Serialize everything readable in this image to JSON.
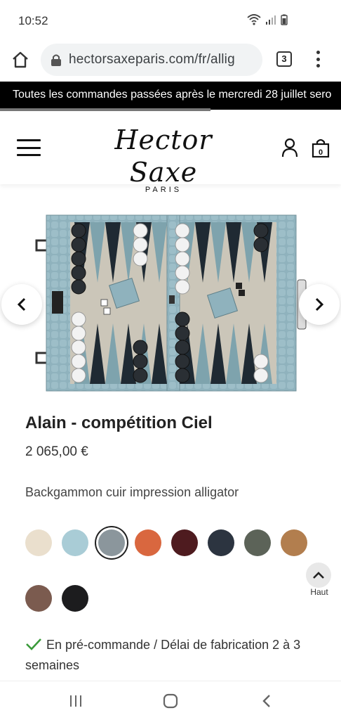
{
  "status_bar": {
    "time": "10:52"
  },
  "browser": {
    "url": "hectorsaxeparis.com/fr/allig",
    "tab_count": "3"
  },
  "promo": {
    "text": "Toutes les commandes passées après le mercredi 28 juillet sero"
  },
  "header": {
    "logo_main": "Hector Saxe",
    "logo_sub": "PARIS"
  },
  "product": {
    "title": "Alain - compétition Ciel",
    "price": "2 065,00 €",
    "description": "Backgammon cuir impression alligator",
    "availability": "En pré-commande / Délai de fabrication 2 à 3 semaines"
  },
  "swatches": [
    {
      "color": "#eadfcd",
      "selected": false
    },
    {
      "color": "#a9ccd6",
      "selected": false
    },
    {
      "color": "#8b969c",
      "selected": true
    },
    {
      "color": "#d9673f",
      "selected": false
    },
    {
      "color": "#4e1b1f",
      "selected": false
    },
    {
      "color": "#2c3440",
      "selected": false
    },
    {
      "color": "#5c6358",
      "selected": false
    },
    {
      "color": "#b27e4e",
      "selected": false
    },
    {
      "color": "#7b5b4f",
      "selected": false
    },
    {
      "color": "#1c1c1e",
      "selected": false
    }
  ],
  "scroll_top": {
    "label": "Haut"
  },
  "colors": {
    "banner_bg": "#000000",
    "check_green": "#3a9a3a"
  }
}
